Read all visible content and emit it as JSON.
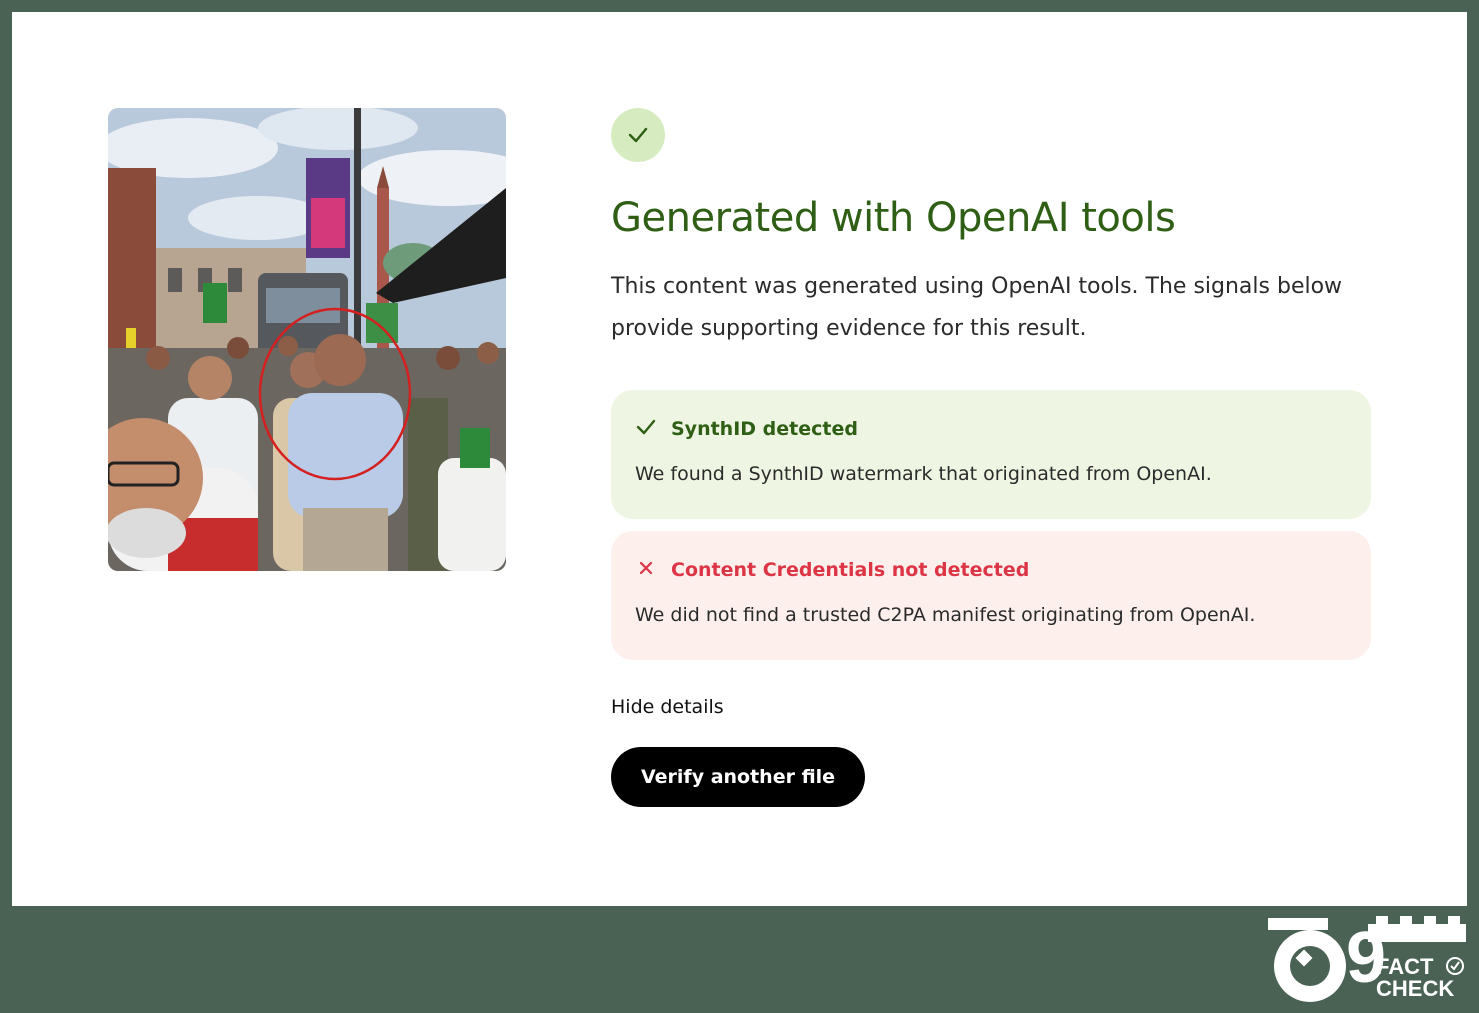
{
  "result": {
    "status_icon": "check-icon",
    "title": "Generated with OpenAI tools",
    "description": "This content was generated using OpenAI tools. The signals below provide supporting evidence for this result."
  },
  "signals": [
    {
      "icon": "check-icon",
      "label": "SynthID detected",
      "detail": "We found a SynthID watermark that originated from OpenAI.",
      "status_color": "#2e5f14",
      "background": "#eef6e3"
    },
    {
      "icon": "cross-icon",
      "label": "Content Credentials not detected",
      "detail": "We did not find a trusted C2PA manifest originating from OpenAI.",
      "status_color": "#dc3545",
      "background": "#fdefec"
    }
  ],
  "actions": {
    "hide_details": "Hide details",
    "verify_another": "Verify another file"
  },
  "watermark": {
    "icon": "factcheck-logo",
    "number": "9",
    "line1": "FACT",
    "line2": "CHECK"
  },
  "colors": {
    "frame": "#496254",
    "title_green": "#2e5f14",
    "success_bg": "#eef6e3",
    "error_red": "#dc3545",
    "error_bg": "#fdefec",
    "button_bg": "#000000"
  }
}
